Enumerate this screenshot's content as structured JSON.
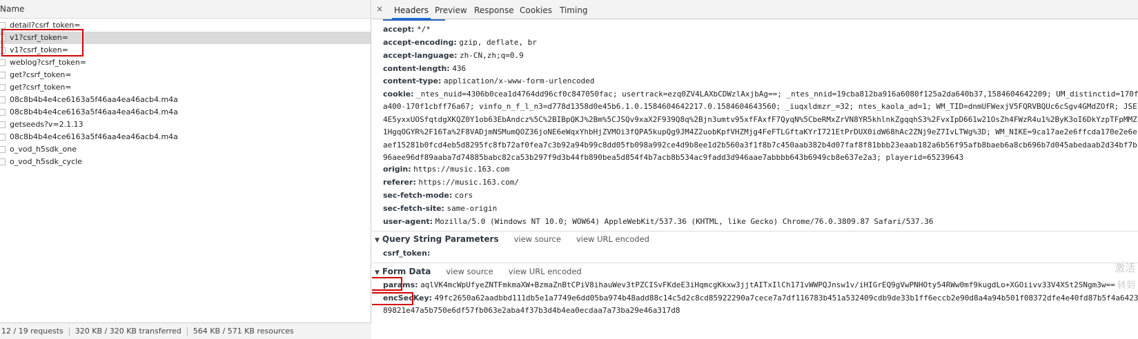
{
  "requests": {
    "header": "Name",
    "items": [
      {
        "name": "detail?csrf_token="
      },
      {
        "name": "v1?csrf_token="
      },
      {
        "name": "v1?csrf_token="
      },
      {
        "name": "weblog?csrf_token="
      },
      {
        "name": "get?csrf_token="
      },
      {
        "name": "get?csrf_token="
      },
      {
        "name": "08c8b4b4e4ce6163a5f46aa4ea46acb4.m4a"
      },
      {
        "name": "08c8b4b4e4ce6163a5f46aa4ea46acb4.m4a"
      },
      {
        "name": "getseeds?v=2.1.13"
      },
      {
        "name": "08c8b4b4e4ce6163a5f46aa4ea46acb4.m4a"
      },
      {
        "name": "o_vod_h5sdk_one"
      },
      {
        "name": "o_vod_h5sdk_cycle"
      }
    ]
  },
  "status": {
    "requests": "12 / 19 requests",
    "transferred": "320 KB / 320 KB transferred",
    "resources": "564 KB / 571 KB resources"
  },
  "tabs": {
    "close": "×",
    "headers": "Headers",
    "preview": "Preview",
    "response": "Response",
    "cookies": "Cookies",
    "timing": "Timing"
  },
  "headers": {
    "accept": {
      "k": "accept:",
      "v": "*/*"
    },
    "accept_encoding": {
      "k": "accept-encoding:",
      "v": "gzip, deflate, br"
    },
    "accept_language": {
      "k": "accept-language:",
      "v": "zh-CN,zh;q=0.9"
    },
    "content_length": {
      "k": "content-length:",
      "v": "436"
    },
    "content_type": {
      "k": "content-type:",
      "v": "application/x-www-form-urlencoded"
    },
    "cookie_key": "cookie:",
    "cookie_lines": [
      "_ntes_nuid=4306b0cea1d4764dd96cf0c847050fac; usertrack=ezq0ZV4LAXbCDWzlAxjbAg==; _ntes_nnid=19cba812ba916a6080f125a2da640b37,1584604642209; UM_distinctid=170f",
      "a400-170f1cbff76a67; vinfo_n_f_l_n3=d778d1358d0e45b6.1.0.1584604642217.0.1584604643560; _iuqxldmzr_=32; ntes_kaola_ad=1; WM_TID=dnmUFWexjV5FQRVBQUc6cSgv4GMdZOfR; JSE",
      "4E5yxxUOSfqtdgXKQZ0Y1ob63EbAndcz%5C%2BIBpQKJ%2Bm%5CJSQv9xaX2F939Q8q%2Bjn3umtv95xfFAxfF7QyqN%5CbeRMxZrVN8YR5khlnkZgqqhS3%2FvxIpD661w21OsZh4FWzR4u1%2ByK3oI6DkYzpTFpMMZ",
      "1HgqOGYR%2F16Ta%2F8VADjmNSMumQOZ36joNE6eWqxYhbHjZVMOi3fQPA5kupQg9JM4Z2uobKpfVHZMjg4FeFTLGftaKYrI721EtPrDUX0idW68hAc2ZNj9eZ7IvLTWg%3D; WM_NIKE=9ca17ae2e6ffcda170e2e6e",
      "aef15281b0fcd4eb5d8295fc8fb72af0fea7c3b92a94b99c8dd05fb098a992ce4d9b8ee1d2b560a3f1f8b7c450aab382b4d07faf8f81bbb23eaab182a6b56f95afb8baeb6a8cb696b7d045abedaab2d34bf7b",
      "96aee96df89aaba7d74885babc82ca53b297f9d3b44fb890bea5d854f4b7acb8b534ac9fadd3d946aae7abbbb643b6949cb8e637e2a3; playerid=65239643"
    ],
    "origin": {
      "k": "origin:",
      "v": "https://music.163.com"
    },
    "referer": {
      "k": "referer:",
      "v": "https://music.163.com/"
    },
    "sec_fetch_mode": {
      "k": "sec-fetch-mode:",
      "v": "cors"
    },
    "sec_fetch_site": {
      "k": "sec-fetch-site:",
      "v": "same-origin"
    },
    "user_agent": {
      "k": "user-agent:",
      "v": "Mozilla/5.0 (Windows NT 10.0; WOW64) AppleWebKit/537.36 (KHTML, like Gecko) Chrome/76.0.3809.87 Safari/537.36"
    }
  },
  "query": {
    "title": "Query String Parameters",
    "view_source": "view source",
    "view_url_encoded": "view URL encoded",
    "csrf_token": {
      "k": "csrf_token:",
      "v": ""
    }
  },
  "form": {
    "title": "Form Data",
    "view_source": "view source",
    "view_url_encoded": "view URL encoded",
    "params": {
      "k": "params:",
      "v": "aqlVK4mcWpUfyeZNTFmkmaXW+BzmaZnBtCPiV8ihauWev3tPZCISvFKdeE3iHqmcgKkxw3jjtAITxIlCh171vWWPQJnsw1v/iHIGrEQ9gVwPNHOty54RWw0mf9kugdLo+XGOiivv33V4XSt2SNgm3w=="
    },
    "encseckey": {
      "k": "encSecKey:",
      "v": "49fc2650a62aadbbd111db5e1a7749e6dd05ba974b48add88c14c5d2c8cd85922290a7cece7a7df116783b451a532409cdb9de33b1ff6eccb2e90d8a4a94b501f08372dfe4e40fd87b5f4a6423b",
      "v2": "89821e47a5b750e6df57fb063e2aba4f37b3d4b4ea0ecdaa7a73ba29e46a317d8"
    }
  },
  "watermark": [
    "激活",
    "转到"
  ]
}
